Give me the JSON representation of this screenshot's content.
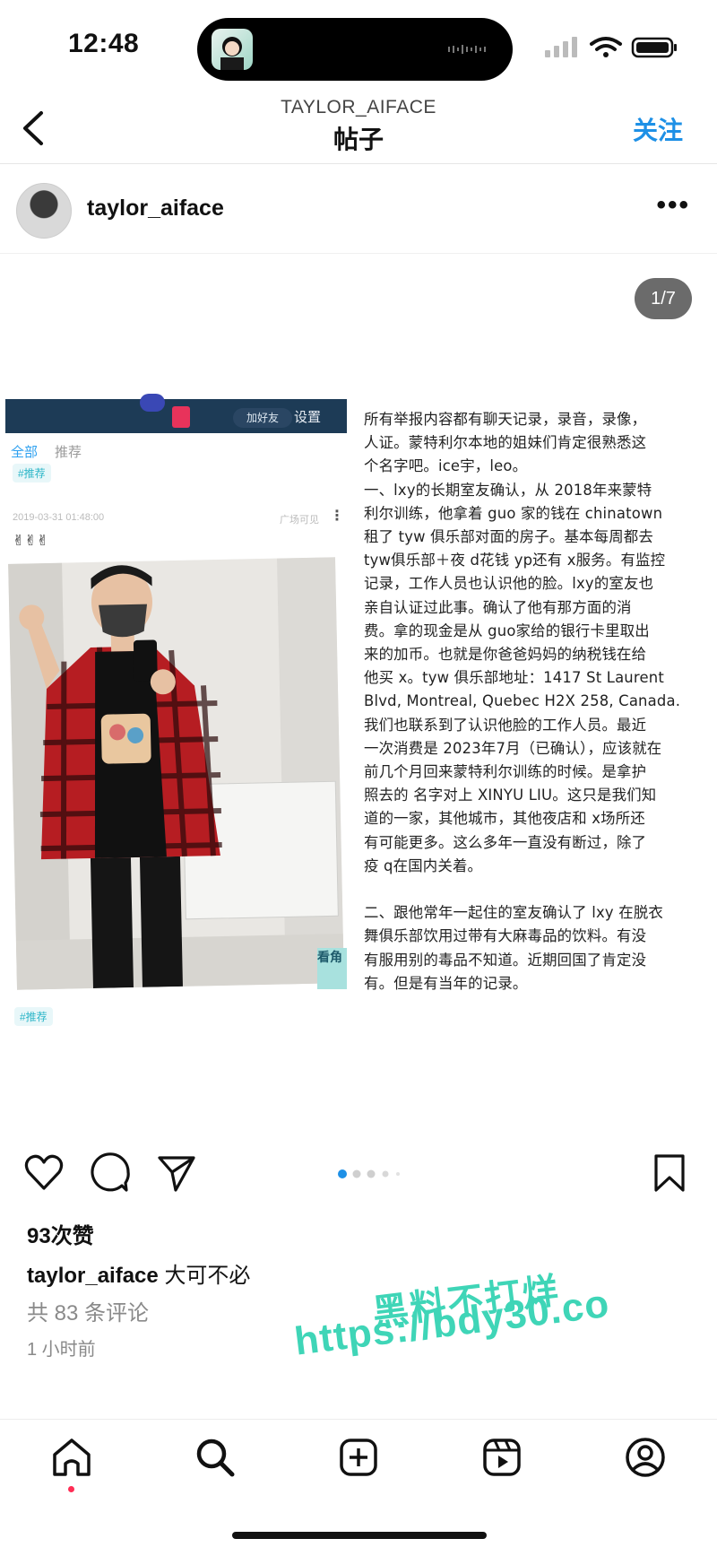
{
  "status_bar": {
    "time": "12:48"
  },
  "nav": {
    "account": "TAYLOR_AIFACE",
    "title": "帖子",
    "follow": "关注"
  },
  "post": {
    "username": "taylor_aiface",
    "counter": "1/7",
    "screenshot": {
      "add_friend": "加好友",
      "settings": "设置",
      "tab_all": "全部",
      "tab_recommend": "推荐",
      "tag": "#推荐",
      "date": "2019-03-31 01:48:00",
      "visibility": "广场可见",
      "emoji": "✌✌✌",
      "tag_bottom": "#推荐",
      "sticker": "看角"
    },
    "body_text": "所有举报内容都有聊天记录，录音，录像，\n人证。蒙特利尔本地的姐妹们肯定很熟悉这\n个名字吧。ice宇，leo。\n一、lxy的长期室友确认，从 2018年来蒙特\n利尔训练，他拿着 guo 家的钱在 chinatown\n租了 tyw 俱乐部对面的房子。基本每周都去\ntyw俱乐部＋夜 d花钱 yp还有 x服务。有监控\n记录，工作人员也认识他的脸。lxy的室友也\n亲自认证过此事。确认了他有那方面的消\n费。拿的现金是从 guo家给的银行卡里取出\n来的加币。也就是你爸爸妈妈的纳税钱在给\n他买 x。tyw 俱乐部地址：1417 St Laurent\nBlvd, Montreal, Quebec H2X 258, Canada.\n我们也联系到了认识他脸的工作人员。最近\n一次消费是 2023年7月（已确认），应该就在\n前几个月回来蒙特利尔训练的时候。是拿护\n照去的 名字对上 XINYU LIU。这只是我们知\n道的一家，其他城市，其他夜店和 x场所还\n有可能更多。这么多年一直没有断过，除了\n疫 q在国内关着。\n\n二、跟他常年一起住的室友确认了 lxy 在脱衣\n舞俱乐部饮用过带有大麻毒品的饮料。有没\n有服用别的毒品不知道。近期回国了肯定没\n有。但是有当年的记录。",
    "likes": "93次赞",
    "caption_user": "taylor_aiface",
    "caption_text": "大可不必",
    "comments": "共 83 条评论",
    "time_ago": "1 小时前"
  },
  "watermark": {
    "line1": "黑料不打烊",
    "line2": "https://bdy30.co"
  },
  "colors": {
    "accent": "#1e90e6",
    "watermark": "#3fd5b7"
  }
}
